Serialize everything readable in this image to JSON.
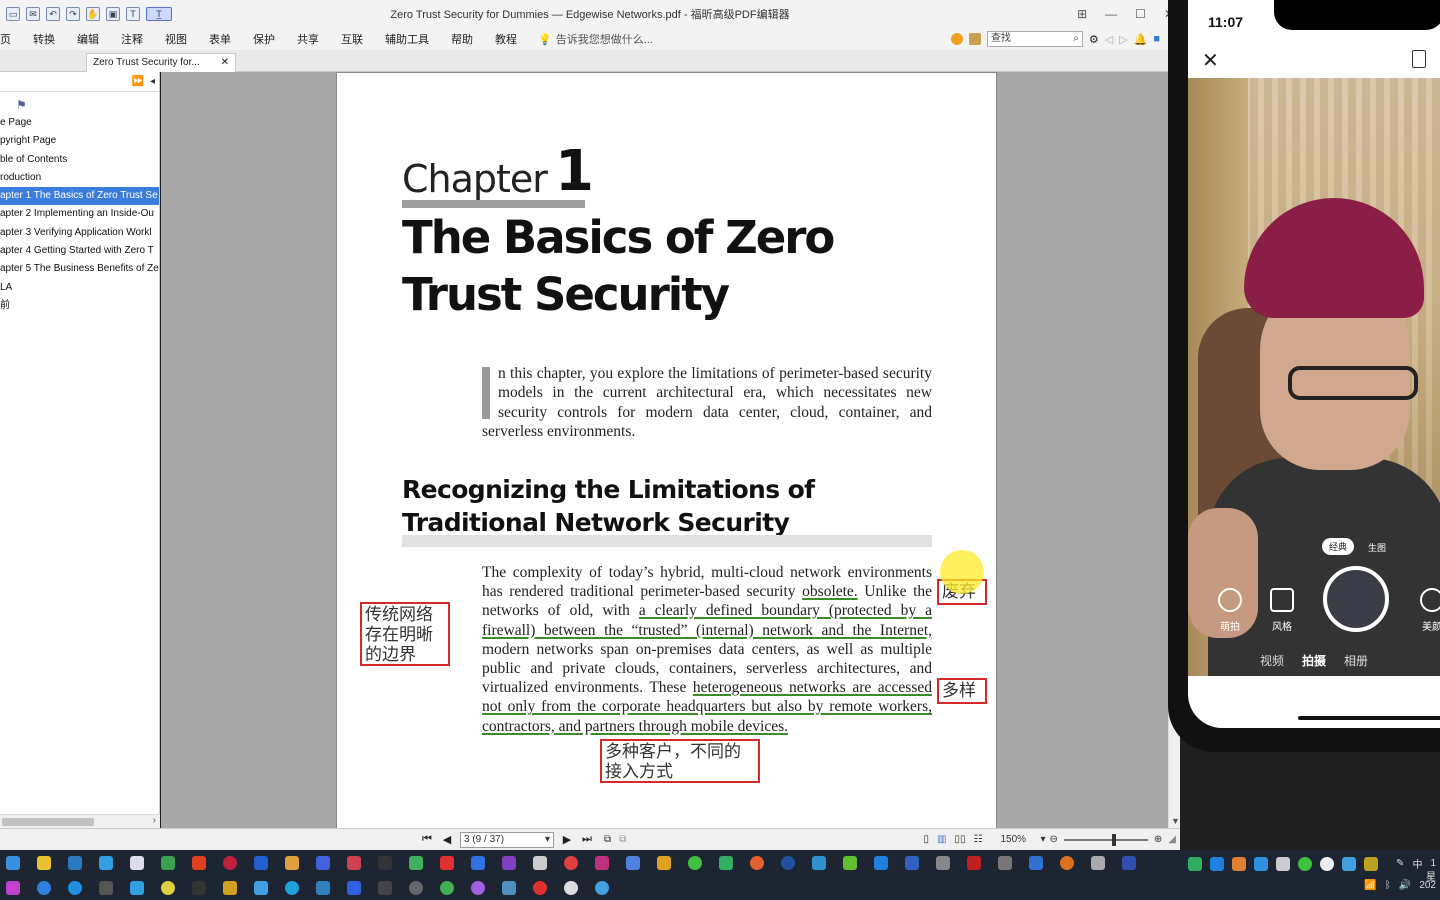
{
  "app": {
    "title": "Zero Trust Security for Dummies — Edgewise Networks.pdf - 福昕高级PDF编辑器",
    "window_controls": [
      "⊞",
      "—",
      "☐",
      "✕"
    ]
  },
  "quick_access": [
    "▭",
    "✉",
    "↶",
    "↷",
    "✋",
    "▣",
    "T",
    "T̲"
  ],
  "menu": {
    "items": [
      "页",
      "转换",
      "编辑",
      "注释",
      "视图",
      "表单",
      "保护",
      "共享",
      "互联",
      "辅助工具",
      "帮助",
      "教程"
    ],
    "tell_me": "告诉我您想做什么...",
    "search_placeholder": "查找"
  },
  "tabs": {
    "doc_tab_label": "Zero Trust Security for...",
    "close": "✕"
  },
  "sidebar": {
    "header_controls": [
      "⏩",
      "◂"
    ],
    "tool_icon": "bookmark-tool-icon",
    "bookmarks": [
      "e Page",
      "pyright Page",
      "ble of Contents",
      "roduction",
      "apter 1  The Basics of Zero Trust Se",
      "apter 2 Implementing an Inside-Ou",
      "apter 3 Verifying Application Workl",
      "apter 4 Getting Started with Zero T",
      "apter 5 The Business Benefits of Ze",
      "LA",
      "前"
    ],
    "selected_index": 4
  },
  "document": {
    "chapter_word": "Chapter",
    "chapter_number": "1",
    "chapter_title": "The Basics of Zero Trust Security",
    "intro_dropcap": "I",
    "intro_text": "n this chapter, you explore the limitations of perimeter-based security models in the current architectural era, which necessitates new security controls for modern data center, cloud, container, and serverless environments.",
    "section_title": "Recognizing the Limitations of Traditional Network Security",
    "body": {
      "p1": "The complexity of today’s hybrid, multi-cloud network environments has rendered traditional perimeter-based security ",
      "u1": "obsolete.",
      "p2": " Unlike the networks of old, with ",
      "u2": "a clearly defined boundary (protected by a firewall) between the “trusted” (internal) network and the Internet,",
      "p3": " modern networks span on-premises data centers, as well as multiple public and private clouds, containers, serverless architectures, and virtualized environments. These ",
      "u3": "heterogeneous networks are accessed not only from the corporate headquarters but also by remote workers, contractors, and partners through mobile devices."
    },
    "annotations": {
      "left_note": "传统网络存在明晰的边界",
      "obsolete_note": "废弃",
      "diverse_note": "多样",
      "access_note": "多种客户，不同的接入方式"
    }
  },
  "statusbar": {
    "page_indicator": "3 (9 / 37)",
    "zoom": "150%",
    "nav": [
      "⏮",
      "◀",
      "▶",
      "⏭"
    ]
  },
  "phone": {
    "time": "11:07",
    "close": "✕",
    "mode_active": "经典",
    "mode_other": "生图",
    "options": [
      "萌拍",
      "风格",
      "美颜"
    ],
    "tabs": [
      "视频",
      "拍摄",
      "相册"
    ],
    "active_tab": "拍摄"
  },
  "taskbar": {
    "ime": "中",
    "clock_partial": "1",
    "weekday_partial": "星",
    "year_partial": "202"
  },
  "colors": {
    "selection": "#3b7ddd",
    "annotation_red": "#d32a2a",
    "underline_green": "#3d8c2a",
    "hat": "#8a1e46"
  }
}
